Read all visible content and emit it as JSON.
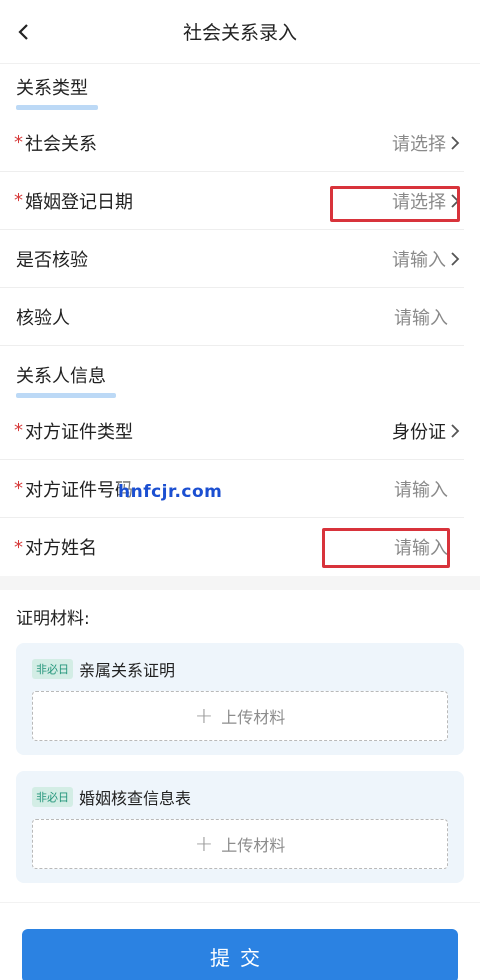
{
  "header": {
    "title": "社会关系录入"
  },
  "relation_section": {
    "title": "关系类型",
    "rows": [
      {
        "label": "社会关系",
        "required": "*",
        "value": "请选择"
      },
      {
        "label": "婚姻登记日期",
        "required": "*",
        "value": "请选择"
      },
      {
        "label": "是否核验",
        "value": "请输入"
      },
      {
        "label": "核验人",
        "value": "请输入"
      }
    ]
  },
  "person_section": {
    "title": "关系人信息",
    "rows": [
      {
        "label": "对方证件类型",
        "required": "*",
        "value": "身份证"
      },
      {
        "label": "对方证件号码",
        "required": "*",
        "value": "请输入"
      },
      {
        "label": "对方姓名",
        "required": "*",
        "value": "请输入"
      }
    ]
  },
  "materials": {
    "title": "证明材料:",
    "items": [
      {
        "tag": "非必日",
        "name": "亲属关系证明",
        "upload_label": "上传材料"
      },
      {
        "tag": "非必日",
        "name": "婚姻核查信息表",
        "upload_label": "上传材料"
      }
    ]
  },
  "watermark": "hnfcjr.com",
  "submit_label": "提交",
  "colors": {
    "accent": "#2b82e2",
    "required": "#d63a3a",
    "highlight": "#d8333b"
  }
}
